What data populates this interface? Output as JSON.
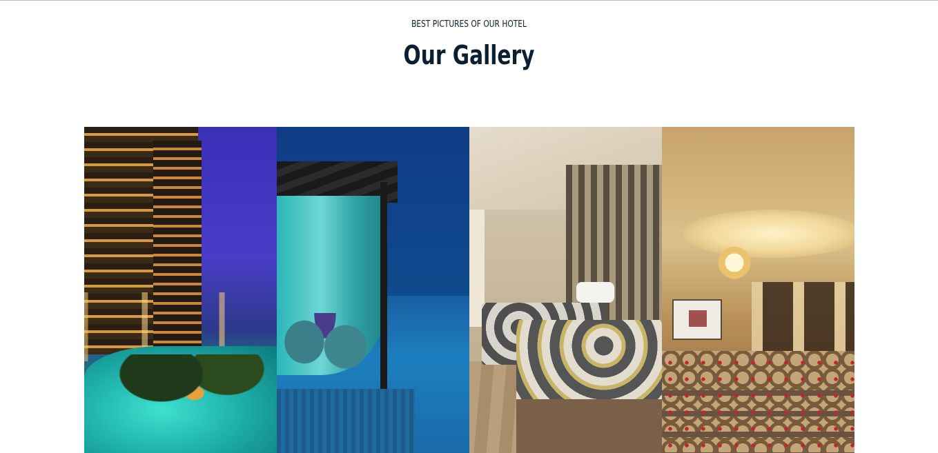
{
  "section": {
    "subtitle": "BEST PICTURES OF OUR HOTEL",
    "title": "Our Gallery"
  },
  "gallery": {
    "images": [
      {
        "name": "hotel-pool-night"
      },
      {
        "name": "poolside-cabana"
      },
      {
        "name": "twin-bed-room"
      },
      {
        "name": "conference-hall"
      }
    ]
  }
}
